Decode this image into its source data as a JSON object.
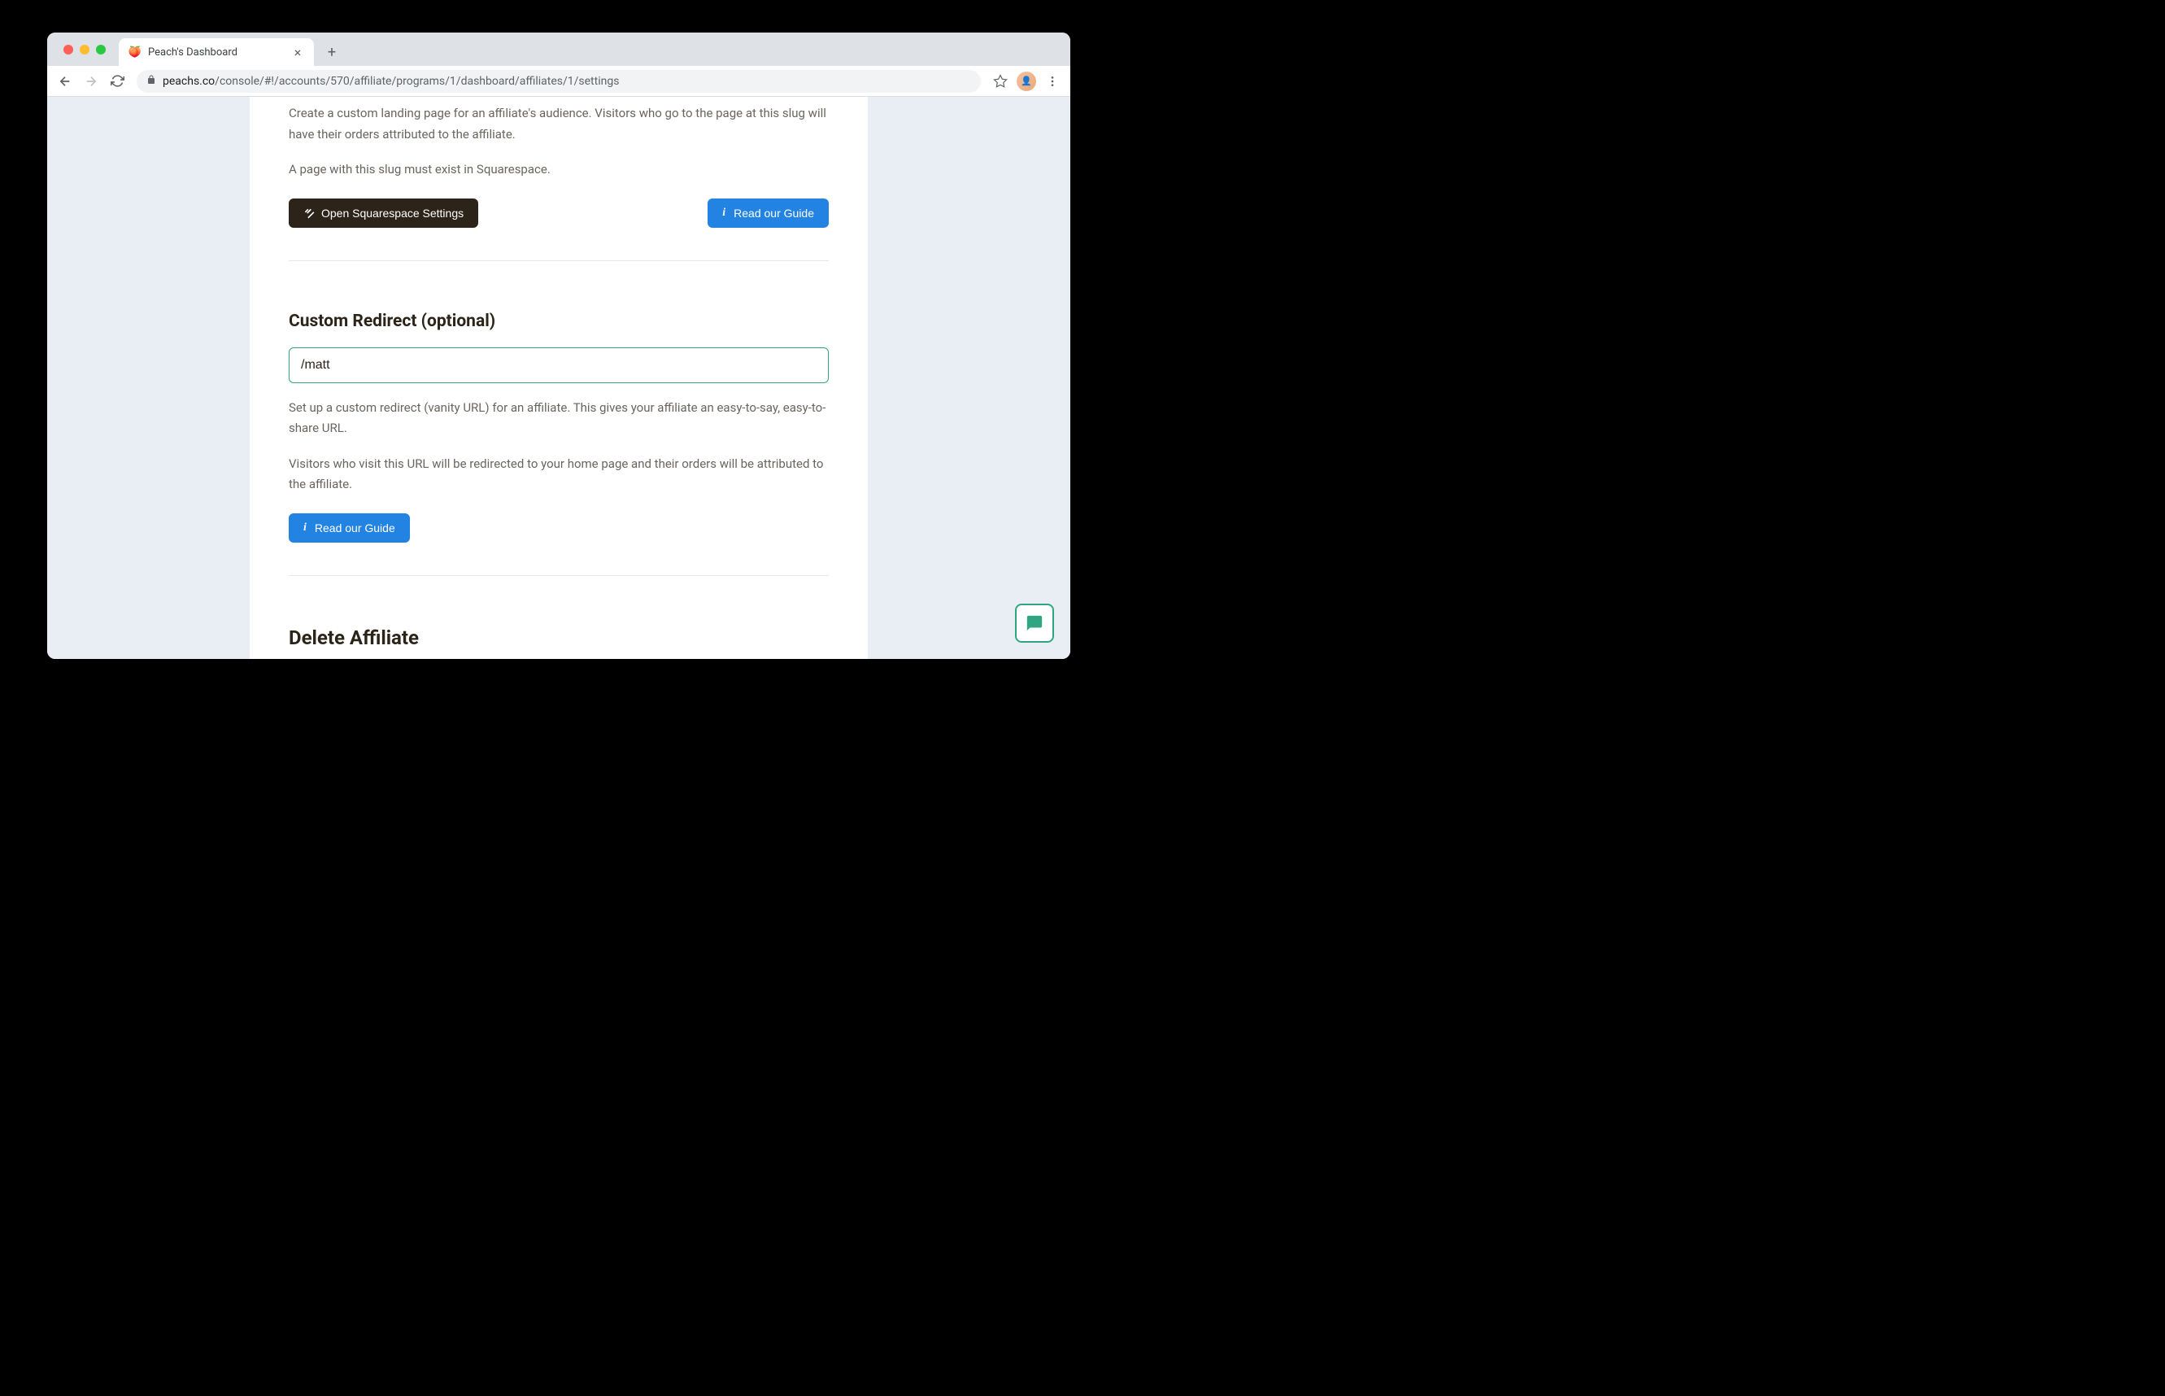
{
  "browser": {
    "tab_title": "Peach's Dashboard",
    "url_domain": "peachs.co",
    "url_path": "/console/#!/accounts/570/affiliate/programs/1/dashboard/affiliates/1/settings"
  },
  "landing_page": {
    "desc1": "Create a custom landing page for an affiliate's audience. Visitors who go to the page at this slug will have their orders attributed to the affiliate.",
    "desc2": "A page with this slug must exist in Squarespace.",
    "btn_squarespace": "Open Squarespace Settings",
    "btn_guide": "Read our Guide"
  },
  "custom_redirect": {
    "title": "Custom Redirect (optional)",
    "input_value": "/matt",
    "desc1": "Set up a custom redirect (vanity URL) for an affiliate. This gives your affiliate an easy-to-say, easy-to-share URL.",
    "desc2": "Visitors who visit this URL will be redirected to your home page and their orders will be attributed to the affiliate.",
    "btn_guide": "Read our Guide"
  },
  "delete": {
    "title": "Delete Affiliate"
  }
}
